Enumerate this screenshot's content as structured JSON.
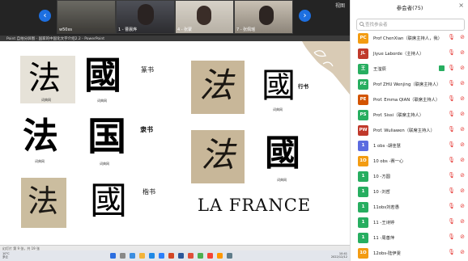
{
  "meeting": {
    "tiles": [
      {
        "name": "w50xs"
      },
      {
        "name": "1 - 曹晨烨"
      },
      {
        "name": "4 - 张蒙"
      },
      {
        "name": "7 - 张佩瑶"
      }
    ],
    "view_label": "视图",
    "nav_left": "‹",
    "nav_right": "›"
  },
  "ppt": {
    "titlebar": "Point 自拍分屏图 - 国家的中国化文字介绍2.2 - PowerPoint",
    "status": "幻灯片 第 9 张，共 19 张",
    "row1_label": "篆书",
    "row2_label": "隶书",
    "row3_label": "楷书",
    "row4_label": "行书",
    "caption": "词典网",
    "seal_char": "國",
    "kaishu_char": "國",
    "li_fa": "法",
    "li_guo": "国",
    "fa_char": "法",
    "guo_trad": "國",
    "la_france": "LA FRANCE",
    "taskbar_weather_temp": "10°C",
    "taskbar_weather_desc": "多云",
    "taskbar_time": "10:41",
    "taskbar_date": "2022/12/12"
  },
  "panel": {
    "title": "参会者(75)",
    "close": "×",
    "search_placeholder": "查找参会者",
    "participants": [
      {
        "initials": "PC",
        "name": "Prof ChenXian（联席主持人，我）",
        "color": "#f39c12",
        "host_icon": false
      },
      {
        "initials": "JL",
        "name": "Jiyue Laborde（主持人）",
        "color": "#c0392b",
        "host_icon": false
      },
      {
        "initials": "王",
        "name": "王滢辰",
        "color": "#27ae60",
        "host_icon": true
      },
      {
        "initials": "PZ",
        "name": "Prof ZHU Wenjing（联席主持人）",
        "color": "#27ae60",
        "host_icon": false
      },
      {
        "initials": "PE",
        "name": "Prof. Emma QIAN（联席主持人）",
        "color": "#d35400",
        "host_icon": false
      },
      {
        "initials": "PS",
        "name": "Prof. Sissi（联席主持人）",
        "color": "#27ae60",
        "host_icon": false
      },
      {
        "initials": "PW",
        "name": "Prof. Wuliawen（联席主持人）",
        "color": "#c0392b",
        "host_icon": false
      },
      {
        "initials": "1",
        "name": "1 obs -胡佳慧",
        "color": "#5b6be0",
        "host_icon": false
      },
      {
        "initials": "1O",
        "name": "10 obs -赛一心",
        "color": "#f39c12",
        "host_icon": false
      },
      {
        "initials": "1",
        "name": "10 -方圆",
        "color": "#27ae60",
        "host_icon": false
      },
      {
        "initials": "1",
        "name": "10 -刘哲",
        "color": "#27ae60",
        "host_icon": false
      },
      {
        "initials": "1",
        "name": "11obs刘若愚",
        "color": "#27ae60",
        "host_icon": false
      },
      {
        "initials": "1",
        "name": "11 -王诗婷",
        "color": "#27ae60",
        "host_icon": false
      },
      {
        "initials": "1",
        "name": "11 -周善萍",
        "color": "#27ae60",
        "host_icon": false
      },
      {
        "initials": "1O",
        "name": "12obs-陆伊雯",
        "color": "#f39c12",
        "host_icon": false
      }
    ]
  }
}
